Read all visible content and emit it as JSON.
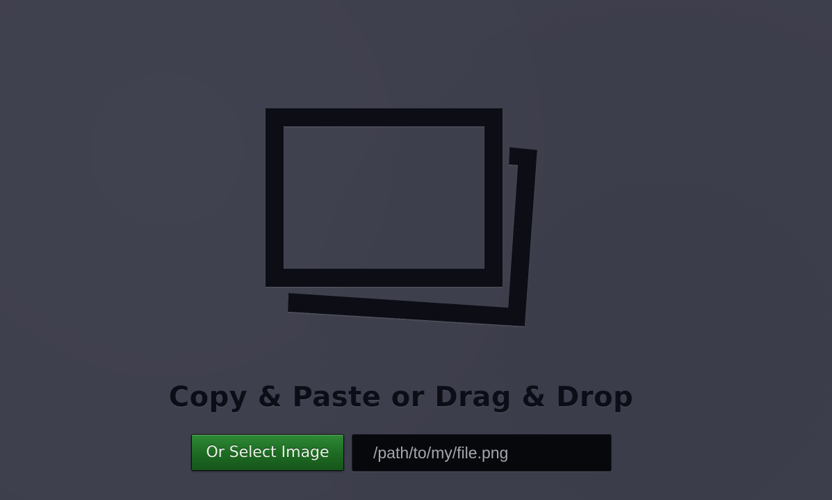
{
  "drop_zone": {
    "icon": "photos-stack-icon",
    "headline": "Copy & Paste or Drag & Drop"
  },
  "controls": {
    "select_button_label": "Or Select Image",
    "path_placeholder": "/path/to/my/file.png"
  },
  "colors": {
    "background": "#3e3f4d",
    "icon": "#0b0e17",
    "button_green": "#1d6a22",
    "field_background": "#07080c"
  }
}
